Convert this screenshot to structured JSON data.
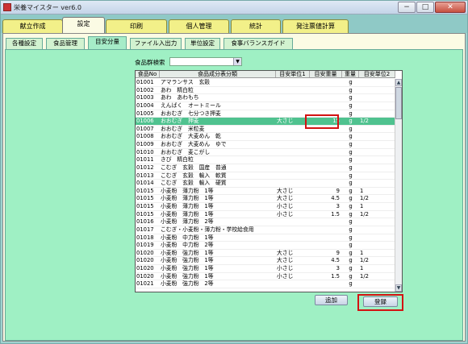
{
  "window": {
    "title": "栄養マイスター ver6.0",
    "minimize": "−",
    "maximize": "□",
    "close": "✕"
  },
  "main_tabs": [
    "献立作成",
    "設定",
    "印刷",
    "個人管理",
    "統計",
    "発注票値計算"
  ],
  "sub_tabs": [
    "各種設定",
    "食品管理",
    "目安分量",
    "ファイル入出力",
    "単位設定",
    "食事バランスガイド"
  ],
  "search": {
    "label": "食品群検索",
    "value": ""
  },
  "table": {
    "headers": [
      "食品No",
      "食品成分表分類",
      "目安単位1",
      "目安重量",
      "重量",
      "目安単位2"
    ],
    "rows": [
      [
        "01001",
        "アマランサス　玄穀",
        "",
        "",
        "g",
        ""
      ],
      [
        "01002",
        "あわ　精白粒",
        "",
        "",
        "g",
        ""
      ],
      [
        "01003",
        "あわ　あわもち",
        "",
        "",
        "g",
        ""
      ],
      [
        "01004",
        "えんばく　オートミール",
        "",
        "",
        "g",
        ""
      ],
      [
        "01005",
        "おおむぎ　七分つき押麦",
        "",
        "",
        "g",
        ""
      ],
      [
        "01006",
        "おおむぎ　押麦",
        "大さじ",
        "15",
        "g",
        "1/2"
      ],
      [
        "01007",
        "おおむぎ　米粒麦",
        "",
        "",
        "g",
        ""
      ],
      [
        "01008",
        "おおむぎ　大麦めん　乾",
        "",
        "",
        "g",
        ""
      ],
      [
        "01009",
        "おおむぎ　大麦めん　ゆで",
        "",
        "",
        "g",
        ""
      ],
      [
        "01010",
        "おおむぎ　麦こがし",
        "",
        "",
        "g",
        ""
      ],
      [
        "01011",
        "きび　精白粒",
        "",
        "",
        "g",
        ""
      ],
      [
        "01012",
        "こむぎ　玄穀　国産　普通",
        "",
        "",
        "g",
        ""
      ],
      [
        "01013",
        "こむぎ　玄穀　輸入　軟質",
        "",
        "",
        "g",
        ""
      ],
      [
        "01014",
        "こむぎ　玄穀　輸入　硬質",
        "",
        "",
        "g",
        ""
      ],
      [
        "01015",
        "小麦粉　薄力粉　1等",
        "大さじ",
        "9",
        "g",
        "1"
      ],
      [
        "01015",
        "小麦粉　薄力粉　1等",
        "大さじ",
        "4.5",
        "g",
        "1/2"
      ],
      [
        "01015",
        "小麦粉　薄力粉　1等",
        "小さじ",
        "3",
        "g",
        "1"
      ],
      [
        "01015",
        "小麦粉　薄力粉　1等",
        "小さじ",
        "1.5",
        "g",
        "1/2"
      ],
      [
        "01016",
        "小麦粉　薄力粉　2等",
        "",
        "",
        "g",
        ""
      ],
      [
        "01017",
        "こむぎ・小麦粉・薄力粉・学校給食用",
        "",
        "",
        "g",
        ""
      ],
      [
        "01018",
        "小麦粉　中力粉　1等",
        "",
        "",
        "g",
        ""
      ],
      [
        "01019",
        "小麦粉　中力粉　2等",
        "",
        "",
        "g",
        ""
      ],
      [
        "01020",
        "小麦粉　強力粉　1等",
        "大さじ",
        "9",
        "g",
        "1"
      ],
      [
        "01020",
        "小麦粉　強力粉　1等",
        "大さじ",
        "4.5",
        "g",
        "1/2"
      ],
      [
        "01020",
        "小麦粉　強力粉　1等",
        "小さじ",
        "3",
        "g",
        "1"
      ],
      [
        "01020",
        "小麦粉　強力粉　1等",
        "小さじ",
        "1.5",
        "g",
        "1/2"
      ],
      [
        "01021",
        "小麦粉　強力粉　2等",
        "",
        "",
        "g",
        ""
      ]
    ]
  },
  "buttons": {
    "add": "追加",
    "register": "登録"
  }
}
